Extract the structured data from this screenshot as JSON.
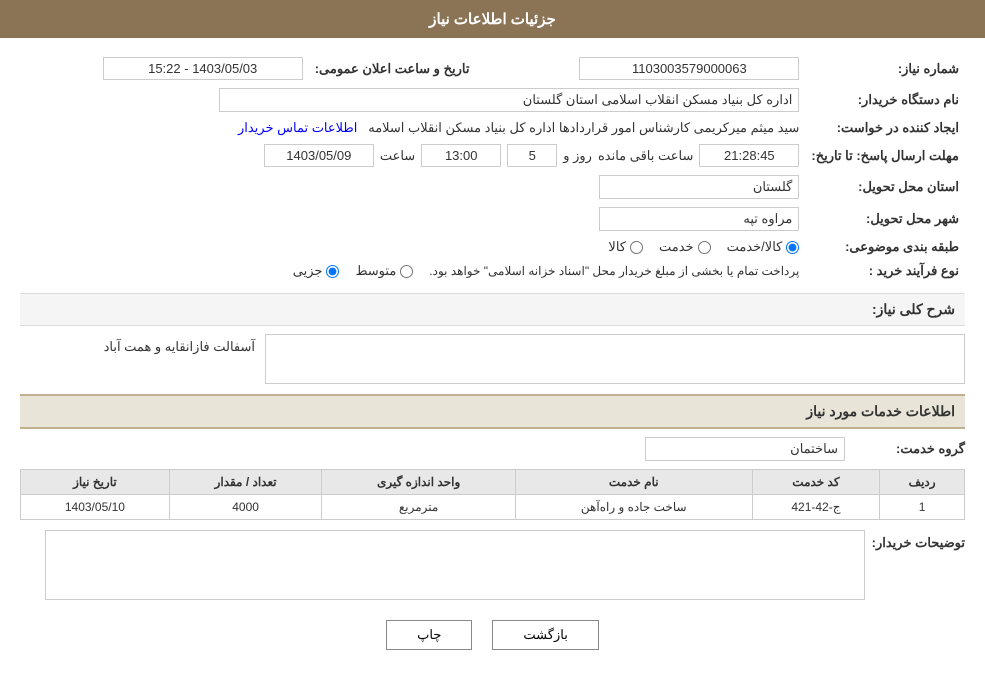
{
  "header": {
    "title": "جزئیات اطلاعات نیاز"
  },
  "fields": {
    "need_number_label": "شماره نیاز:",
    "need_number_value": "1103003579000063",
    "announce_date_label": "تاریخ و ساعت اعلان عمومی:",
    "announce_date_value": "1403/05/03 - 15:22",
    "buyer_org_label": "نام دستگاه خریدار:",
    "buyer_org_value": "اداره کل بنیاد مسکن انقلاب اسلامی استان گلستان",
    "creator_label": "ایجاد کننده در خواست:",
    "creator_value": "سید میثم میرکریمی کارشناس امور قراردادها اداره کل بنیاد مسکن انقلاب اسلامه",
    "contact_link": "اطلاعات تماس خریدار",
    "expire_label": "مهلت ارسال پاسخ: تا تاریخ:",
    "expire_date": "1403/05/09",
    "expire_time_label": "ساعت",
    "expire_time": "13:00",
    "expire_days_label": "روز و",
    "expire_days": "5",
    "expire_remaining_label": "ساعت باقی مانده",
    "expire_remaining": "21:28:45",
    "province_label": "استان محل تحویل:",
    "province_value": "گلستان",
    "city_label": "شهر محل تحویل:",
    "city_value": "مراوه تپه",
    "category_label": "طبقه بندی موضوعی:",
    "category_options": [
      {
        "label": "کالا",
        "value": "kala"
      },
      {
        "label": "خدمت",
        "value": "khedmat"
      },
      {
        "label": "کالا/خدمت",
        "value": "kala_khedmat"
      }
    ],
    "category_selected": "kala_khedmat",
    "process_label": "نوع فرآیند خرید :",
    "process_options": [
      {
        "label": "جزیی",
        "value": "jozii"
      },
      {
        "label": "متوسط",
        "value": "motavaset"
      }
    ],
    "process_note": "پرداخت تمام یا بخشی از مبلغ خریدار محل \"اسناد خزانه اسلامی\" خواهد بود.",
    "process_selected": "jozii"
  },
  "description": {
    "section_title": "شرح کلی نیاز:",
    "value": "آسفالت فازانقایه و همت آباد"
  },
  "services": {
    "section_title": "اطلاعات خدمات مورد نیاز",
    "group_label": "گروه خدمت:",
    "group_value": "ساختمان",
    "table": {
      "columns": [
        {
          "label": "ردیف"
        },
        {
          "label": "کد خدمت"
        },
        {
          "label": "نام خدمت"
        },
        {
          "label": "واحد اندازه گیری"
        },
        {
          "label": "تعداد / مقدار"
        },
        {
          "label": "تاریخ نیاز"
        }
      ],
      "rows": [
        {
          "row_num": "1",
          "service_code": "ج-42-421",
          "service_name": "ساخت جاده و راه‌آهن",
          "unit": "مترمربع",
          "quantity": "4000",
          "need_date": "1403/05/10"
        }
      ]
    }
  },
  "buyer_notes": {
    "label": "توضیحات خریدار:",
    "value": ""
  },
  "buttons": {
    "print_label": "چاپ",
    "back_label": "بازگشت"
  }
}
